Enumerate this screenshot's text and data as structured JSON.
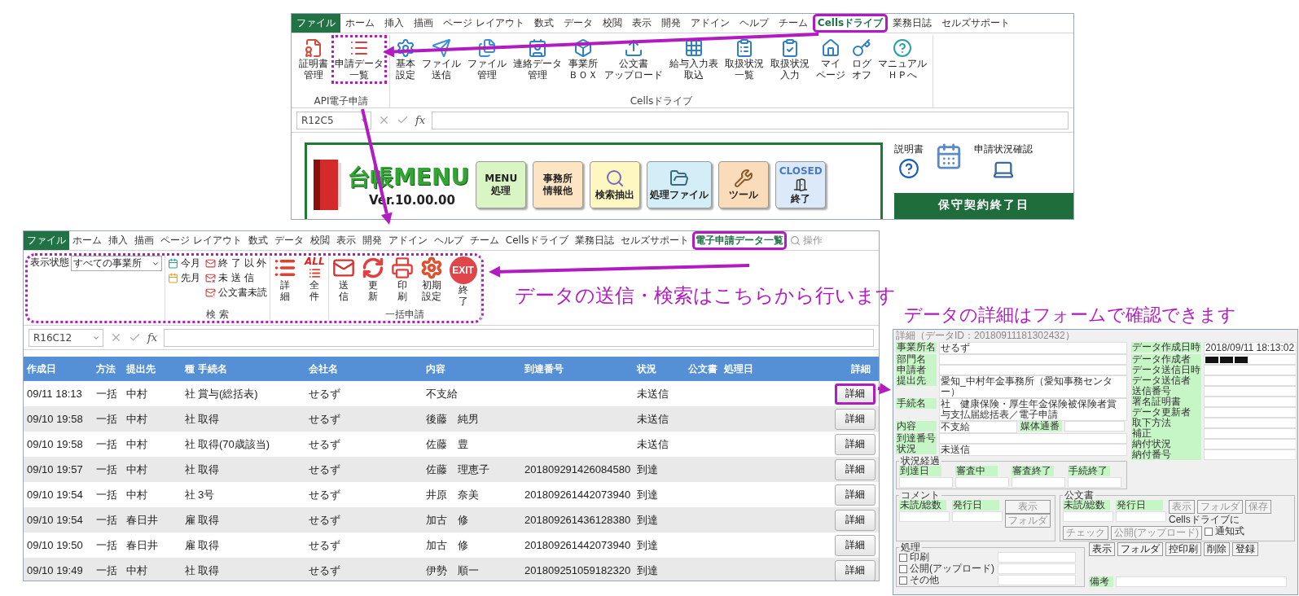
{
  "top_window": {
    "tabs": [
      {
        "label": "ファイル",
        "kind": "file",
        "selected": false,
        "circled": false
      },
      {
        "label": "ホーム",
        "kind": "tab",
        "selected": false,
        "circled": false
      },
      {
        "label": "挿入",
        "kind": "tab",
        "selected": false,
        "circled": false
      },
      {
        "label": "描画",
        "kind": "tab",
        "selected": false,
        "circled": false
      },
      {
        "label": "ページ レイアウト",
        "kind": "tab",
        "selected": false,
        "circled": false
      },
      {
        "label": "数式",
        "kind": "tab",
        "selected": false,
        "circled": false
      },
      {
        "label": "データ",
        "kind": "tab",
        "selected": false,
        "circled": false
      },
      {
        "label": "校閲",
        "kind": "tab",
        "selected": false,
        "circled": false
      },
      {
        "label": "表示",
        "kind": "tab",
        "selected": false,
        "circled": false
      },
      {
        "label": "開発",
        "kind": "tab",
        "selected": false,
        "circled": false
      },
      {
        "label": "アドイン",
        "kind": "tab",
        "selected": false,
        "circled": false
      },
      {
        "label": "ヘルプ",
        "kind": "tab",
        "selected": false,
        "circled": false
      },
      {
        "label": "チーム",
        "kind": "tab",
        "selected": false,
        "circled": false
      },
      {
        "label": "Cellsドライブ",
        "kind": "tab",
        "selected": true,
        "circled": true
      },
      {
        "label": "業務日誌",
        "kind": "tab",
        "selected": false,
        "circled": false
      },
      {
        "label": "セルズサポート",
        "kind": "tab",
        "selected": false,
        "circled": false
      }
    ],
    "ribbon_groups": [
      {
        "label": "API電子申請",
        "buttons": [
          {
            "lines": [
              "証明書",
              "管理"
            ],
            "circled": false
          },
          {
            "lines": [
              "申請データ",
              "一覧"
            ],
            "circled": true
          }
        ]
      },
      {
        "label": "Cellsドライブ",
        "buttons": [
          {
            "lines": [
              "基本",
              "設定"
            ],
            "circled": false
          },
          {
            "lines": [
              "ファイル",
              "送信"
            ],
            "circled": false
          },
          {
            "lines": [
              "ファイル",
              "管理"
            ],
            "circled": false
          },
          {
            "lines": [
              "連絡データ",
              "管理"
            ],
            "circled": false
          },
          {
            "lines": [
              "事業所",
              "ＢＯＸ"
            ],
            "circled": false
          },
          {
            "lines": [
              "公文書",
              "アップロード"
            ],
            "circled": false
          },
          {
            "lines": [
              "給与入力表",
              "取込"
            ],
            "circled": false
          },
          {
            "lines": [
              "取扱状況",
              "一覧"
            ],
            "circled": false
          },
          {
            "lines": [
              "取扱状況",
              "入力"
            ],
            "circled": false
          },
          {
            "lines": [
              "マイ",
              "ページ"
            ],
            "circled": false
          },
          {
            "lines": [
              "ログ",
              "オフ"
            ],
            "circled": false
          },
          {
            "lines": [
              "マニュアル",
              "ＨＰへ"
            ],
            "circled": false
          }
        ]
      }
    ],
    "name_box": "R12C5",
    "function_label": "fx",
    "menu": {
      "title": "台帳MENU",
      "version": "Ver.10.00.00",
      "buttons": [
        {
          "kind": "text",
          "lines": [
            "MENU",
            "処理"
          ],
          "color": "#d9f5c4"
        },
        {
          "kind": "text",
          "lines": [
            "事務所",
            "情報他"
          ],
          "color": "#fde5c4"
        },
        {
          "kind": "search",
          "lines": [
            "検索抽出"
          ],
          "color": "#fff7c2"
        },
        {
          "kind": "folder",
          "lines": [
            "処理ファイル"
          ],
          "color": "#d3eef6"
        },
        {
          "kind": "tools",
          "lines": [
            "ツール"
          ],
          "color": "#fbdcba"
        },
        {
          "kind": "closed",
          "title": "CLOSED",
          "lines": [
            "終了"
          ],
          "color": "#dce9f9"
        }
      ]
    },
    "side": {
      "manual_label": "説明書",
      "status_label": "申請状況確認",
      "banner": "保守契約終了日"
    }
  },
  "callouts": [
    {
      "text": "データの送信・検索はこちらから行います"
    },
    {
      "text": "データの詳細はフォームで確認できます"
    }
  ],
  "list_window": {
    "tabs": [
      {
        "label": "ファイル",
        "kind": "file",
        "selected": false,
        "circled": false
      },
      {
        "label": "ホーム",
        "kind": "tab",
        "selected": false,
        "circled": false
      },
      {
        "label": "挿入",
        "kind": "tab",
        "selected": false,
        "circled": false
      },
      {
        "label": "描画",
        "kind": "tab",
        "selected": false,
        "circled": false
      },
      {
        "label": "ページ レイアウト",
        "kind": "tab",
        "selected": false,
        "circled": false
      },
      {
        "label": "数式",
        "kind": "tab",
        "selected": false,
        "circled": false
      },
      {
        "label": "データ",
        "kind": "tab",
        "selected": false,
        "circled": false
      },
      {
        "label": "校閲",
        "kind": "tab",
        "selected": false,
        "circled": false
      },
      {
        "label": "表示",
        "kind": "tab",
        "selected": false,
        "circled": false
      },
      {
        "label": "開発",
        "kind": "tab",
        "selected": false,
        "circled": false
      },
      {
        "label": "アドイン",
        "kind": "tab",
        "selected": false,
        "circled": false
      },
      {
        "label": "ヘルプ",
        "kind": "tab",
        "selected": false,
        "circled": false
      },
      {
        "label": "チーム",
        "kind": "tab",
        "selected": false,
        "circled": false
      },
      {
        "label": "Cellsドライブ",
        "kind": "tab",
        "selected": false,
        "circled": false
      },
      {
        "label": "業務日誌",
        "kind": "tab",
        "selected": false,
        "circled": false
      },
      {
        "label": "セルズサポート",
        "kind": "tab",
        "selected": false,
        "circled": false
      },
      {
        "label": "電子申請データ一覧",
        "kind": "tab",
        "selected": true,
        "circled": true
      }
    ],
    "search_placeholder": "操作",
    "ribbon": {
      "circled": true,
      "view_label": "表示状態",
      "view_select": "すべての事業所",
      "search_group": {
        "label": "検 索",
        "columns": [
          [
            "今月",
            "先月"
          ],
          [
            "終 了 以 外",
            "未 送 信",
            "公文書未読"
          ]
        ]
      },
      "display_buttons": [
        {
          "kind": "detail",
          "lines": [
            "詳",
            "細"
          ]
        },
        {
          "kind": "all",
          "icon_text": "ALL",
          "lines": [
            "全",
            "件"
          ]
        }
      ],
      "batch_group": {
        "label": "一括申請",
        "buttons": [
          {
            "kind": "send",
            "lines": [
              "送",
              "信"
            ]
          },
          {
            "kind": "refresh",
            "lines": [
              "更",
              "新"
            ]
          },
          {
            "kind": "print",
            "lines": [
              "印",
              "刷"
            ]
          },
          {
            "kind": "settings",
            "lines": [
              "初期",
              "設定"
            ]
          },
          {
            "kind": "exit",
            "icon_text": "EXIT",
            "lines": [
              "終",
              "了"
            ]
          }
        ]
      }
    },
    "name_box": "R16C12",
    "function_label": "fx",
    "table": {
      "columns": [
        "作成日",
        "方法",
        "提出先",
        "種",
        "手続名",
        "会社名",
        "内容",
        "到達番号",
        "状況",
        "公文書",
        "処理日",
        "詳細"
      ],
      "rows": [
        {
          "created": "09/11 18:13",
          "method": "一括",
          "office": "中村",
          "type": "社",
          "procedure": "賞与(総括表)",
          "company": "せるず",
          "content": "不支給",
          "status": "未送信",
          "detail": "詳細",
          "circled": true
        },
        {
          "created": "09/10 19:58",
          "method": "一括",
          "office": "中村",
          "type": "社",
          "procedure": "取得",
          "company": "せるず",
          "content": "後藤　純男",
          "status": "未送信",
          "detail": "詳細",
          "circled": false
        },
        {
          "created": "09/10 19:58",
          "method": "一括",
          "office": "中村",
          "type": "社",
          "procedure": "取得(70歳該当)",
          "company": "せるず",
          "content": "佐藤　豊",
          "status": "未送信",
          "detail": "詳細",
          "circled": false
        },
        {
          "created": "09/10 19:57",
          "method": "一括",
          "office": "中村",
          "type": "社",
          "procedure": "取得",
          "company": "せるず",
          "content": "佐藤　理恵子",
          "arrival_no": "201809291426084580",
          "status": "到達",
          "detail": "詳細",
          "circled": false
        },
        {
          "created": "09/10 19:54",
          "method": "一括",
          "office": "中村",
          "type": "社",
          "procedure": "3号",
          "company": "せるず",
          "content": "井原　奈美",
          "arrival_no": "201809261442073940",
          "status": "到達",
          "detail": "詳細",
          "circled": false
        },
        {
          "created": "09/10 19:54",
          "method": "一括",
          "office": "春日井",
          "type": "雇",
          "procedure": "取得",
          "company": "せるず",
          "content": "加古　修",
          "arrival_no": "201809261436128380",
          "status": "到達",
          "detail": "詳細",
          "circled": false
        },
        {
          "created": "09/10 19:50",
          "method": "一括",
          "office": "春日井",
          "type": "雇",
          "procedure": "取得",
          "company": "せるず",
          "content": "加古　修",
          "arrival_no": "201809261442073940",
          "status": "到達",
          "detail": "詳細",
          "circled": false
        },
        {
          "created": "09/10 19:49",
          "method": "一括",
          "office": "中村",
          "type": "社",
          "procedure": "取得",
          "company": "せるず",
          "content": "伊勢　順一",
          "arrival_no": "201809251059182320",
          "status": "到達",
          "detail": "詳細",
          "circled": false
        }
      ]
    }
  },
  "detail_form": {
    "title": "詳細（データID：20180911181302432）",
    "fields_left": [
      {
        "label": "事業所名",
        "value": "せるず"
      },
      {
        "label": "部門名"
      },
      {
        "label": "申請者"
      },
      {
        "label": "提出先",
        "value": "愛知_中村年金事務所（愛知事務センター）"
      },
      {
        "label": "手続名",
        "value": "社　健康保険・厚生年金保険被保険者賞与支払届総括表／電子申請"
      },
      {
        "label": "内容",
        "value": "不支給",
        "extra_label": "媒体通番"
      },
      {
        "label": "到達番号"
      },
      {
        "label": "状況",
        "value": "未送信"
      }
    ],
    "fields_right": [
      {
        "label": "データ作成日時",
        "value": "2018/09/11 18:13:02"
      },
      {
        "label": "データ作成者",
        "redacted": true
      },
      {
        "label": "データ送信日時"
      },
      {
        "label": "データ送信者"
      },
      {
        "label": "送信番号"
      },
      {
        "label": "署名証明書"
      },
      {
        "label": "データ更新者"
      },
      {
        "label": "取下方法"
      },
      {
        "label": "補正"
      },
      {
        "label": "納付状況"
      },
      {
        "label": "納付番号"
      }
    ],
    "progress": {
      "legend": "状況経過",
      "labels": [
        "到達日",
        "審査中",
        "審査終了",
        "手続終了"
      ]
    },
    "comment": {
      "legend": "コメント",
      "labels": [
        "未読/総数",
        "発行日"
      ],
      "buttons": [
        {
          "label": "表示",
          "disabled": true
        },
        {
          "label": "フォルダ",
          "disabled": true
        }
      ]
    },
    "document": {
      "legend": "公文書",
      "labels": [
        "未読/総数",
        "発行日"
      ],
      "buttons": [
        {
          "label": "表示",
          "disabled": true
        },
        {
          "label": "フォルダ",
          "disabled": true
        },
        {
          "label": "保存",
          "disabled": true
        }
      ],
      "cells_label": "Cellsドライブに",
      "cells_buttons": [
        {
          "label": "チェック",
          "disabled": true
        },
        {
          "label": "公開(アップロード)",
          "disabled": true
        }
      ],
      "option": {
        "label": "通知式",
        "checked": false
      }
    },
    "process": {
      "legend": "処理",
      "options": [
        {
          "label": "印刷",
          "checked": false
        },
        {
          "label": "公開(アップロード)",
          "checked": false
        },
        {
          "label": "その他",
          "checked": false
        }
      ]
    },
    "remarks_label": "備考",
    "side_buttons": [
      {
        "label": "表示",
        "disabled": false
      },
      {
        "label": "フォルダ",
        "disabled": false
      },
      {
        "label": "控印刷",
        "disabled": false
      },
      {
        "label": "削除",
        "disabled": false
      },
      {
        "label": "登録",
        "disabled": false
      }
    ]
  }
}
